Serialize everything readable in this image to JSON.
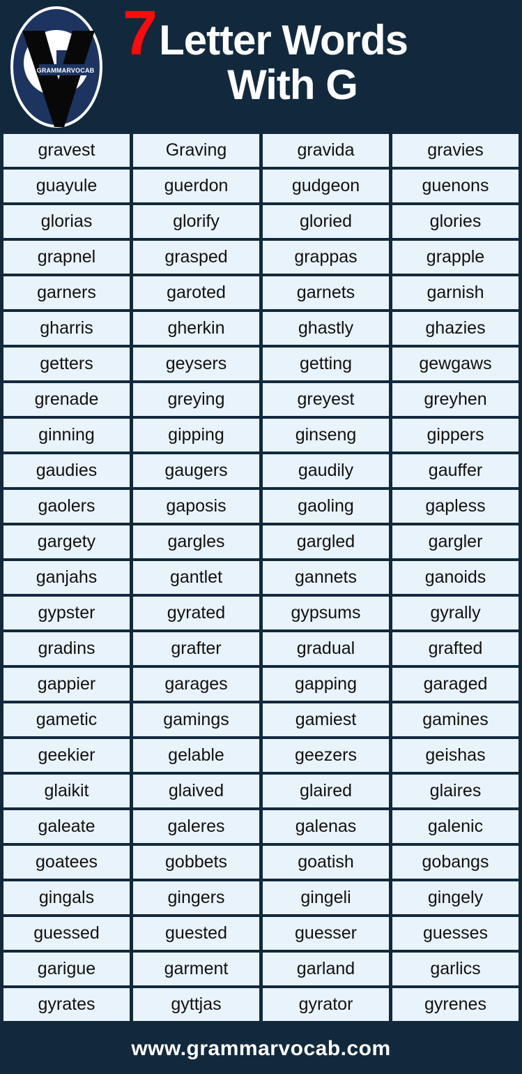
{
  "header": {
    "number": "7",
    "title_line1": "Letter Words",
    "title_line2": "With G",
    "logo_text": "GRAMMARVOCAB",
    "logo_letter": "V"
  },
  "colors": {
    "background": "#12293d",
    "cell_background": "#e9f3fb",
    "number_accent": "#ff0a0a",
    "title_text": "#ffffff",
    "word_text": "#111111",
    "logo_blue": "#1d3461",
    "logo_black": "#080808",
    "logo_white": "#ffffff"
  },
  "footer": {
    "url": "www.grammarvocab.com"
  },
  "grid": {
    "columns": 4,
    "rows": 25,
    "words": [
      [
        "gravest",
        "Graving",
        "gravida",
        "gravies"
      ],
      [
        "guayule",
        "guerdon",
        "gudgeon",
        "guenons"
      ],
      [
        "glorias",
        "glorify",
        "gloried",
        "glories"
      ],
      [
        "grapnel",
        "grasped",
        "grappas",
        "grapple"
      ],
      [
        "garners",
        "garoted",
        "garnets",
        "garnish"
      ],
      [
        "gharris",
        "gherkin",
        "ghastly",
        "ghazies"
      ],
      [
        "getters",
        "geysers",
        "getting",
        "gewgaws"
      ],
      [
        "grenade",
        "greying",
        "greyest",
        "greyhen"
      ],
      [
        "ginning",
        "gipping",
        "ginseng",
        "gippers"
      ],
      [
        "gaudies",
        "gaugers",
        "gaudily",
        "gauffer"
      ],
      [
        "gaolers",
        "gaposis",
        "gaoling",
        "gapless"
      ],
      [
        "gargety",
        "gargles",
        "gargled",
        "gargler"
      ],
      [
        "ganjahs",
        "gantlet",
        "gannets",
        "ganoids"
      ],
      [
        "gypster",
        "gyrated",
        "gypsums",
        "gyrally"
      ],
      [
        "gradins",
        "grafter",
        "gradual",
        "grafted"
      ],
      [
        "gappier",
        "garages",
        "gapping",
        "garaged"
      ],
      [
        "gametic",
        "gamings",
        "gamiest",
        "gamines"
      ],
      [
        "geekier",
        "gelable",
        "geezers",
        "geishas"
      ],
      [
        "glaikit",
        "glaived",
        "glaired",
        "glaires"
      ],
      [
        "galeate",
        "galeres",
        "galenas",
        "galenic"
      ],
      [
        "goatees",
        "gobbets",
        "goatish",
        "gobangs"
      ],
      [
        "gingals",
        "gingers",
        "gingeli",
        "gingely"
      ],
      [
        "guessed",
        "guested",
        "guesser",
        "guesses"
      ],
      [
        "garigue",
        "garment",
        "garland",
        "garlics"
      ],
      [
        "gyrates",
        "gyttjas",
        "gyrator",
        "gyrenes"
      ]
    ]
  }
}
